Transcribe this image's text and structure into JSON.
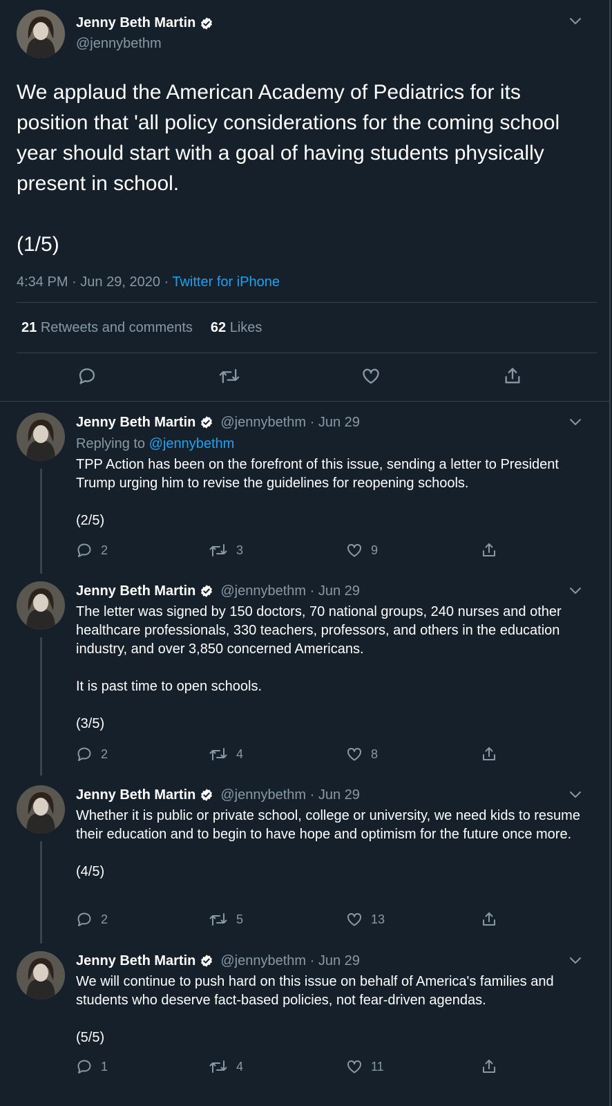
{
  "colors": {
    "background": "#15202b",
    "text": "#ffffff",
    "secondary_text": "#8899a6",
    "link": "#1da1f2",
    "divider": "#38444d"
  },
  "main_tweet": {
    "author_name": "Jenny Beth Martin",
    "author_handle": "@jennybethm",
    "text": "We applaud the American Academy of Pediatrics for its position that 'all policy considerations for the coming school year should start with a goal of having students physically present in school.\n\n(1/5)",
    "time": "4:34 PM",
    "date": "Jun 29, 2020",
    "separator": "·",
    "source": "Twitter for iPhone",
    "retweets_count": "21",
    "retweets_label": "Retweets and comments",
    "likes_count": "62",
    "likes_label": "Likes",
    "icons": [
      "reply-icon",
      "retweet-icon",
      "like-icon",
      "share-icon"
    ]
  },
  "replies": [
    {
      "author_name": "Jenny Beth Martin",
      "meta": "@jennybethm · Jun 29",
      "replying_prefix": "Replying to",
      "replying_to": "@jennybethm",
      "text": "TPP Action has been on the forefront of this issue, sending a letter to President Trump urging him to revise the guidelines for reopening schools.\n\n(2/5)",
      "reply_count": "2",
      "retweet_count": "3",
      "like_count": "9"
    },
    {
      "author_name": "Jenny Beth Martin",
      "meta": "@jennybethm · Jun 29",
      "text": "The letter was signed by 150 doctors, 70 national groups, 240 nurses and other healthcare professionals, 330 teachers, professors, and others in the education industry, and over 3,850 concerned Americans.\n\nIt is past time to open schools.\n\n(3/5)",
      "reply_count": "2",
      "retweet_count": "4",
      "like_count": "8"
    },
    {
      "author_name": "Jenny Beth Martin",
      "meta": "@jennybethm · Jun 29",
      "text": "Whether it is public or private school, college or university, we need kids to resume their education and to begin to have hope and optimism for the future once more.\n\n(4/5)",
      "reply_count": "2",
      "retweet_count": "5",
      "like_count": "13"
    },
    {
      "author_name": "Jenny Beth Martin",
      "meta": "@jennybethm · Jun 29",
      "text": "We will continue to push hard on this issue on behalf of America's families and students who deserve fact-based policies, not fear-driven agendas.\n\n(5/5)",
      "reply_count": "1",
      "retweet_count": "4",
      "like_count": "11"
    }
  ]
}
